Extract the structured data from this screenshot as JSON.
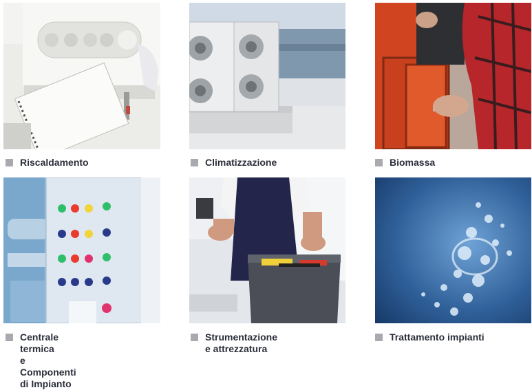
{
  "categories": [
    {
      "label": "Riscaldamento",
      "image": "wall-boiler-image"
    },
    {
      "label": "Climatizzazione",
      "image": "rooftop-hvac-image"
    },
    {
      "label": "Biomassa",
      "image": "biomass-stove-image"
    },
    {
      "label": "Centrale termica\ne Componenti di Impianto",
      "image": "control-panel-image"
    },
    {
      "label": "Strumentazione\ne attrezzatura",
      "image": "toolbox-image"
    },
    {
      "label": "Trattamento impianti",
      "image": "water-bubbles-image"
    }
  ],
  "colors": {
    "caption_text": "#2b2e3a",
    "bullet": "#a9aab0"
  }
}
